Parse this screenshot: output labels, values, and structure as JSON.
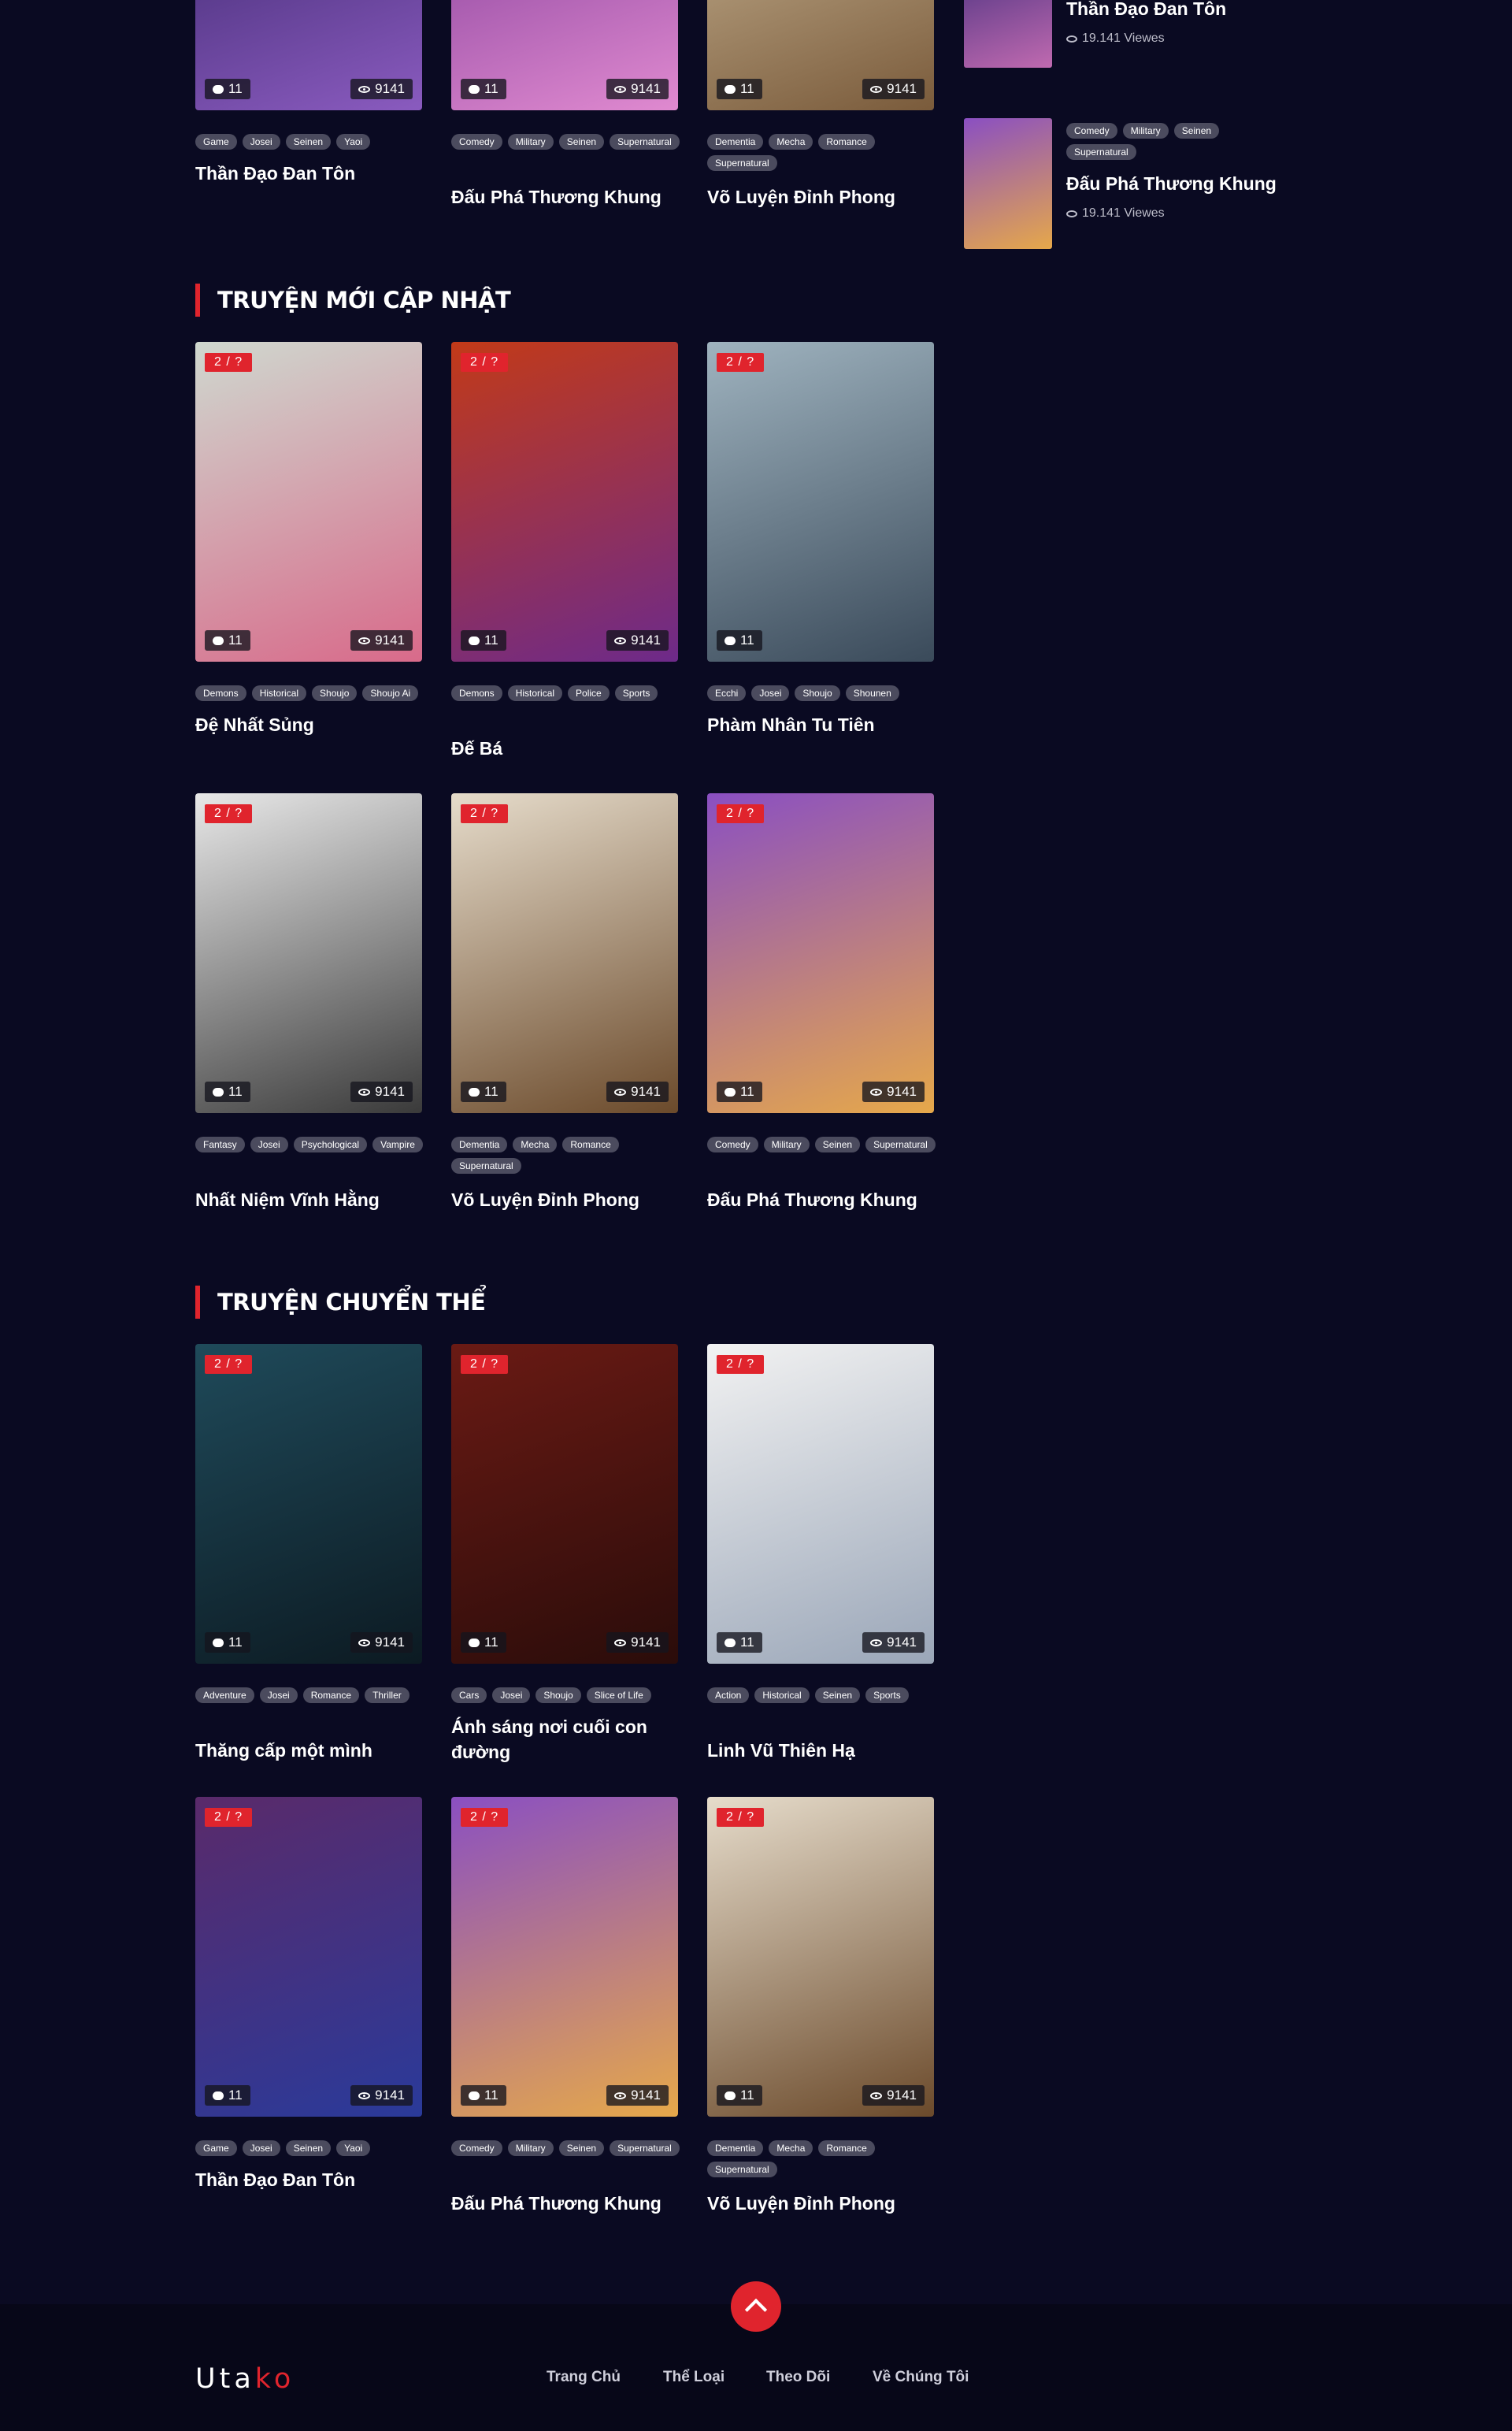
{
  "sections": [
    {
      "title": "TRUYỆN MỚI CẬP NHẬT"
    },
    {
      "title": "TRUYỆN CHUYỂN THỂ"
    }
  ],
  "top_cards": [
    {
      "title": "Thần Đạo Đan Tôn",
      "comments": "11",
      "views": "9141",
      "tags": [
        "Game",
        "Josei",
        "Seinen",
        "Yaoi"
      ],
      "colors": [
        "#2a1b5a",
        "#8a5bbf"
      ]
    },
    {
      "title": "Đấu Phá Thương Khung",
      "comments": "11",
      "views": "9141",
      "tags": [
        "Comedy",
        "Military",
        "Seinen",
        "Supernatural"
      ],
      "colors": [
        "#6b2a8c",
        "#e08ad0"
      ]
    },
    {
      "title": "Võ Luyện Đỉnh Phong",
      "comments": "11",
      "views": "9141",
      "tags": [
        "Dementia",
        "Mecha",
        "Romance",
        "Supernatural"
      ],
      "colors": [
        "#d9c8a8",
        "#7a5b3b"
      ]
    }
  ],
  "new_cards": [
    {
      "title": "Đệ Nhất Sủng",
      "badge": "2 / ?",
      "comments": "11",
      "views": "9141",
      "tags": [
        "Demons",
        "Historical",
        "Shoujo",
        "Shoujo Ai"
      ],
      "colors": [
        "#cfd8cf",
        "#d86a8a"
      ]
    },
    {
      "title": "Đế Bá",
      "badge": "2 / ?",
      "comments": "11",
      "views": "9141",
      "tags": [
        "Demons",
        "Historical",
        "Police",
        "Sports"
      ],
      "colors": [
        "#c23a18",
        "#6d2a8a"
      ]
    },
    {
      "title": "Phàm Nhân Tu Tiên",
      "badge": "2 / ?",
      "comments": "11",
      "views": "",
      "tags": [
        "Ecchi",
        "Josei",
        "Shoujo",
        "Shounen"
      ],
      "colors": [
        "#9fb3bf",
        "#3a4a5a"
      ]
    },
    {
      "title": "Nhất Niệm Vĩnh Hằng",
      "badge": "2 / ?",
      "comments": "11",
      "views": "9141",
      "tags": [
        "Fantasy",
        "Josei",
        "Psychological",
        "Vampire"
      ],
      "colors": [
        "#e8e8e8",
        "#3a3a3a"
      ]
    },
    {
      "title": "Võ Luyện Đỉnh Phong",
      "badge": "2 / ?",
      "comments": "11",
      "views": "9141",
      "tags": [
        "Dementia",
        "Mecha",
        "Romance",
        "Supernatural"
      ],
      "colors": [
        "#e6dccb",
        "#6b4a2b"
      ]
    },
    {
      "title": "Đấu Phá Thương Khung",
      "badge": "2 / ?",
      "comments": "11",
      "views": "9141",
      "tags": [
        "Comedy",
        "Military",
        "Seinen",
        "Supernatural"
      ],
      "colors": [
        "#8a4fc2",
        "#e6a84a"
      ]
    }
  ],
  "adapted_cards": [
    {
      "title": "Thăng cấp một mình",
      "badge": "2 / ?",
      "comments": "11",
      "views": "9141",
      "tags": [
        "Adventure",
        "Josei",
        "Romance",
        "Thriller"
      ],
      "colors": [
        "#1f4a5a",
        "#0c1a22"
      ]
    },
    {
      "title": "Ánh sáng nơi cuối con đường",
      "badge": "2 / ?",
      "comments": "11",
      "views": "9141",
      "tags": [
        "Cars",
        "Josei",
        "Shoujo",
        "Slice of Life"
      ],
      "colors": [
        "#6a1a14",
        "#2a0c0a"
      ]
    },
    {
      "title": "Linh Vũ Thiên Hạ",
      "badge": "2 / ?",
      "comments": "11",
      "views": "9141",
      "tags": [
        "Action",
        "Historical",
        "Seinen",
        "Sports"
      ],
      "colors": [
        "#f2f2f2",
        "#9aa6b8"
      ]
    },
    {
      "title": "Thần Đạo Đan Tôn",
      "badge": "2 / ?",
      "comments": "11",
      "views": "9141",
      "tags": [
        "Game",
        "Josei",
        "Seinen",
        "Yaoi"
      ],
      "colors": [
        "#5a2a6a",
        "#2a3a9a"
      ]
    },
    {
      "title": "Đấu Phá Thương Khung",
      "badge": "2 / ?",
      "comments": "11",
      "views": "9141",
      "tags": [
        "Comedy",
        "Military",
        "Seinen",
        "Supernatural"
      ],
      "colors": [
        "#8a4fc2",
        "#e6a84a"
      ]
    },
    {
      "title": "Võ Luyện Đỉnh Phong",
      "badge": "2 / ?",
      "comments": "11",
      "views": "9141",
      "tags": [
        "Dementia",
        "Mecha",
        "Romance",
        "Supernatural"
      ],
      "colors": [
        "#e6dccb",
        "#6b4a2b"
      ]
    }
  ],
  "sidebar": [
    {
      "title": "Thần Đạo Đan Tôn",
      "views": "19.141 Viewes",
      "tags": [],
      "colors": [
        "#3a2a7a",
        "#c06ab0"
      ]
    },
    {
      "title": "Đấu Phá Thương Khung",
      "views": "19.141 Viewes",
      "tags": [
        "Comedy",
        "Military",
        "Seinen",
        "Supernatural"
      ],
      "colors": [
        "#8a4fc2",
        "#e6a84a"
      ]
    }
  ],
  "footer": {
    "logo_main": "Uta",
    "logo_accent": "ko",
    "nav": [
      "Trang Chủ",
      "Thể Loại",
      "Theo Dõi",
      "Về Chúng Tôi"
    ]
  },
  "theme": {
    "accent": "#e0242d",
    "background": "#0a0a22",
    "tag_bg": "#4b4b5e"
  }
}
